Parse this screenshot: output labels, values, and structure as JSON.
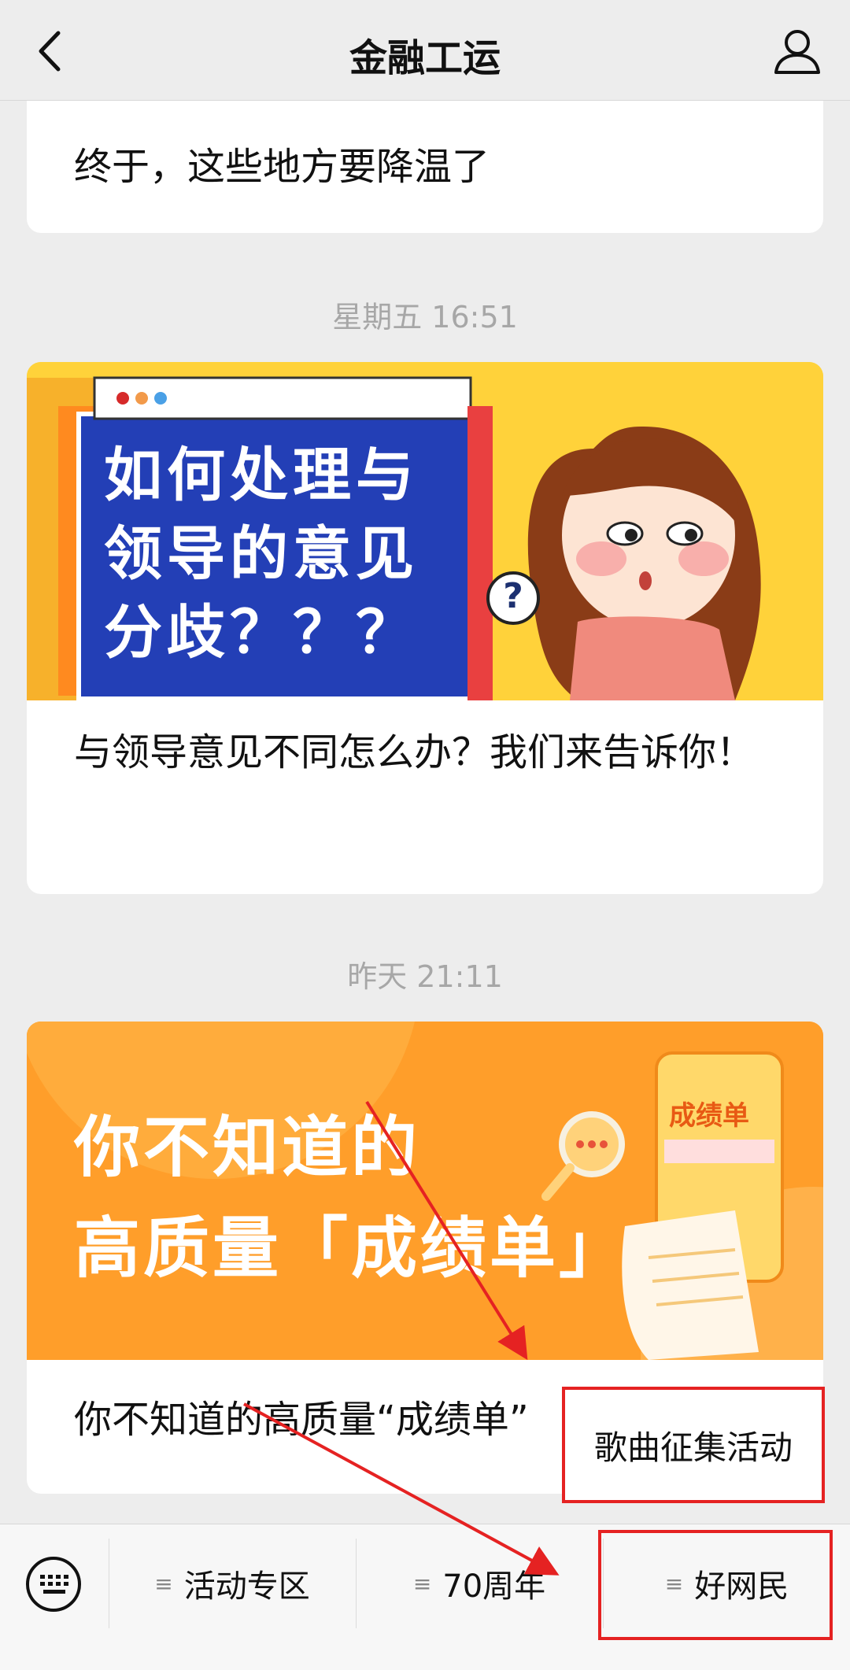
{
  "header": {
    "title": "金融工运",
    "back_icon": "chevron-left-icon",
    "profile_icon": "person-icon"
  },
  "feed": {
    "card1_title": "终于，这些地方要降温了",
    "time2": "星期五 16:51",
    "card2": {
      "cover_lines": [
        "如何处理与",
        "领导的意见",
        "分歧？？？"
      ],
      "cover_badge": "?",
      "title": "与领导意见不同怎么办？我们来告诉你！"
    },
    "time3": "昨天 21:11",
    "card3": {
      "cover_lines": [
        "你不知道的",
        "高质量「成绩单」"
      ],
      "cover_tag": "成绩单",
      "title": "你不知道的高质量“成绩单”"
    }
  },
  "popup": {
    "label": "歌曲征集活动"
  },
  "menubar": {
    "keyboard_icon": "keyboard-icon",
    "items": [
      {
        "label": "活动专区"
      },
      {
        "label": "70周年"
      },
      {
        "label": "好网民"
      }
    ]
  },
  "colors": {
    "annotation_red": "#e52222",
    "background": "#ededed",
    "orange": "#ff9e2a"
  }
}
